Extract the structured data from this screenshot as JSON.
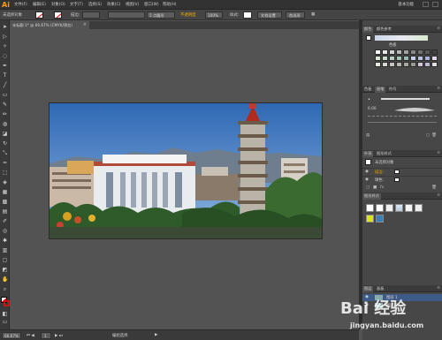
{
  "app": {
    "logo": "Ai"
  },
  "menubar": {
    "items": [
      "文件(F)",
      "编辑(E)",
      "对象(O)",
      "文字(T)",
      "选择(S)",
      "效果(C)",
      "视图(V)",
      "窗口(W)",
      "帮助(H)"
    ],
    "workspace": "基本功能"
  },
  "controlbar": {
    "selection": "未选择对象",
    "stroke_label": "描边:",
    "stroke_value": "",
    "brush_value": "5 点圆形",
    "opacity_label": "不透明度",
    "opacity_value": "100%",
    "style_label": "样式:",
    "doc_setup": "文档设置",
    "preferences": "首选项"
  },
  "document": {
    "tab_title": "未标题-1* @ 66.67% (CMYK/预览)",
    "close": "×"
  },
  "tools": {
    "icons": [
      "selection-tool",
      "direct-selection-tool",
      "magic-wand-tool",
      "lasso-tool",
      "pen-tool",
      "type-tool",
      "line-tool",
      "rectangle-tool",
      "paintbrush-tool",
      "pencil-tool",
      "blob-brush-tool",
      "eraser-tool",
      "rotate-tool",
      "scale-tool",
      "width-tool",
      "free-transform-tool",
      "shape-builder-tool",
      "perspective-grid-tool",
      "mesh-tool",
      "gradient-tool",
      "eyedropper-tool",
      "blend-tool",
      "symbol-sprayer-tool",
      "column-graph-tool",
      "artboard-tool",
      "slice-tool",
      "hand-tool",
      "zoom-tool"
    ],
    "glyphs": [
      "➤",
      "▷",
      "✧",
      "◌",
      "✒",
      "T",
      "╱",
      "▭",
      "✎",
      "✏",
      "◍",
      "◪",
      "↻",
      "⤡",
      "≈",
      "⬚",
      "◈",
      "▦",
      "▩",
      "▤",
      "✐",
      "◎",
      "✱",
      "▥",
      "▢",
      "◩",
      "✋",
      "⌕"
    ]
  },
  "panels": {
    "swatches": {
      "tabs": [
        "颜色",
        "颜色参考"
      ],
      "title": "色板"
    },
    "swatch_colors": [
      "#ffffff",
      "#e8e8e8",
      "#d0d0d0",
      "#b8b8b8",
      "#a0a0a0",
      "#888888",
      "#707070",
      "#585858",
      "#404040",
      "#d8e8d8",
      "#c8dcc8",
      "#b8d0c0",
      "#a8c4b8",
      "#98b8b0",
      "#c8d0e8",
      "#b8c0e0",
      "#a8b0d8",
      "#e0d8e8",
      "#e8e8e0",
      "#d8d8d0",
      "#c8c8c0",
      "#b8b8b0",
      "#a8a8a0",
      "#989890",
      "#d0c8d8",
      "#c0b8d0",
      "#e0e0e0"
    ],
    "brushes": {
      "tabs": [
        "色板",
        "画笔",
        "符号"
      ],
      "stroke_size": "6.00"
    },
    "appearance": {
      "tabs": [
        "外观",
        "图形样式"
      ],
      "title": "未选择对象",
      "rows": [
        "描边:",
        "填色:"
      ]
    },
    "graphic_styles": {
      "tabs": [
        "图形样式"
      ]
    },
    "layers": {
      "tabs": [
        "图层",
        "画板"
      ],
      "rows": [
        "图层 1",
        "图层 2"
      ]
    }
  },
  "statusbar": {
    "zoom": "66.67%",
    "page": "1",
    "tool_name": "编组选择"
  },
  "watermark": {
    "brand": "Bai 经验",
    "site": "jingyan.baidu.com"
  }
}
